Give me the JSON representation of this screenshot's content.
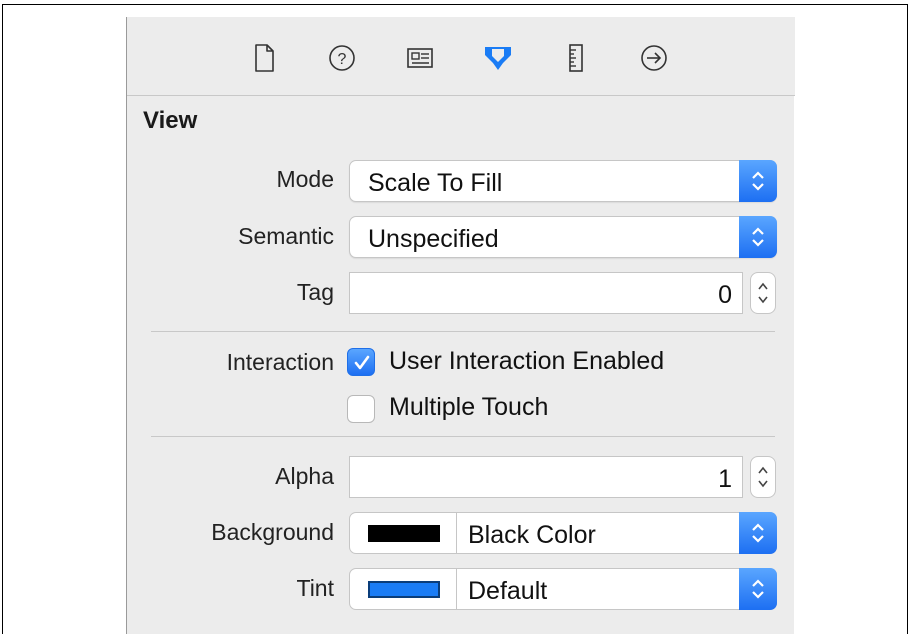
{
  "section": {
    "title": "View"
  },
  "toolbar": {
    "icons": [
      "file-inspector-icon",
      "quick-help-icon",
      "identity-inspector-icon",
      "attributes-inspector-icon",
      "size-inspector-icon",
      "connections-inspector-icon"
    ],
    "active": "attributes-inspector-icon",
    "accent": "#1a7cf5"
  },
  "fields": {
    "mode": {
      "label": "Mode",
      "value": "Scale To Fill"
    },
    "semantic": {
      "label": "Semantic",
      "value": "Unspecified"
    },
    "tag": {
      "label": "Tag",
      "value": "0"
    },
    "interaction": {
      "label": "Interaction",
      "user_interaction": {
        "label": "User Interaction Enabled",
        "checked": true
      },
      "multiple_touch": {
        "label": "Multiple Touch",
        "checked": false
      }
    },
    "alpha": {
      "label": "Alpha",
      "value": "1"
    },
    "background": {
      "label": "Background",
      "value": "Black Color",
      "swatch": "#000000"
    },
    "tint": {
      "label": "Tint",
      "value": "Default",
      "swatch": "#1a7cf5"
    }
  }
}
